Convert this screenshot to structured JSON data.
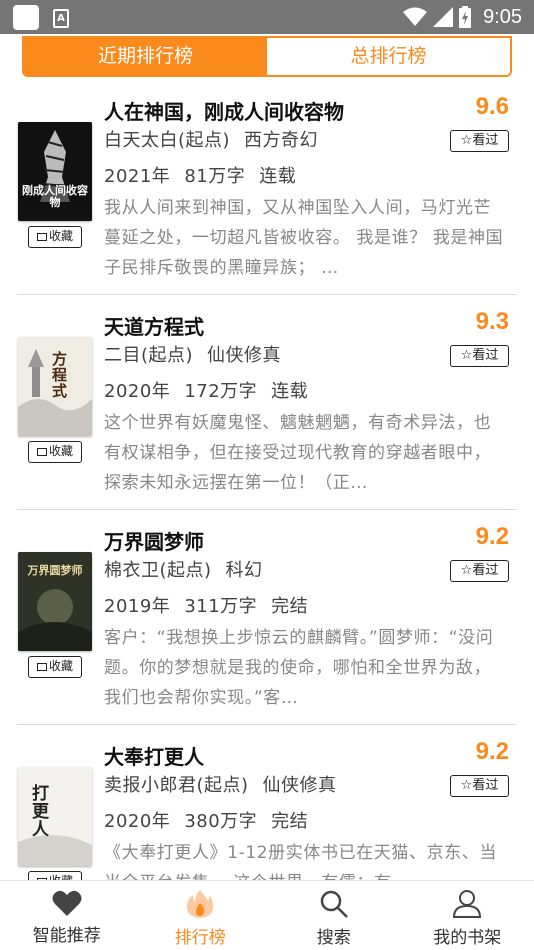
{
  "status_bar": {
    "time": "9:05"
  },
  "tabs": [
    {
      "label": "近期排行榜",
      "active": true
    },
    {
      "label": "总排行榜",
      "active": false
    }
  ],
  "books": [
    {
      "title": "人在神国，刚成人间收容物",
      "score": "9.6",
      "author": "白天太白(起点)",
      "genre": "西方奇幻",
      "year": "2021年",
      "words": "81万字",
      "status": "连载",
      "description": "我从人间来到神国，又从神国坠入人间，马灯光芒蔓延之处，一切超凡皆被收容。 我是谁？ 我是神国子民排斥敬畏的黑瞳异族； …",
      "cover_text": "刚成人间收容物",
      "favorite_label": "收藏",
      "seen_label": "看过"
    },
    {
      "title": "天道方程式",
      "score": "9.3",
      "author": "二目(起点)",
      "genre": "仙侠修真",
      "year": "2020年",
      "words": "172万字",
      "status": "连载",
      "description": "这个世界有妖魔鬼怪、魑魅魍魉，有奇术异法，也有权谋相争，但在接受过现代教育的穿越者眼中，探索未知永远摆在第一位！（正…",
      "cover_text": "方程式",
      "favorite_label": "收藏",
      "seen_label": "看过"
    },
    {
      "title": "万界圆梦师",
      "score": "9.2",
      "author": "棉衣卫(起点)",
      "genre": "科幻",
      "year": "2019年",
      "words": "311万字",
      "status": "完结",
      "description": "客户：“我想换上步惊云的麒麟臂。”圆梦师：“没问题。你的梦想就是我的使命，哪怕和全世界为敌，我们也会帮你实现。”客…",
      "cover_text": "万界圆梦师",
      "favorite_label": "收藏",
      "seen_label": "看过"
    },
    {
      "title": "大奉打更人",
      "score": "9.2",
      "author": "卖报小郎君(起点)",
      "genre": "仙侠修真",
      "year": "2020年",
      "words": "380万字",
      "status": "完结",
      "description": "《大奉打更人》1-12册实体书已在天猫、京东、当当全平台发售。 这个世界，有儒；有…",
      "cover_text": "打更人",
      "favorite_label": "收藏",
      "seen_label": "看过"
    }
  ],
  "bottom_nav": [
    {
      "label": "智能推荐",
      "icon": "heart-icon",
      "active": false
    },
    {
      "label": "排行榜",
      "icon": "flame-icon",
      "active": true
    },
    {
      "label": "搜索",
      "icon": "search-icon",
      "active": false
    },
    {
      "label": "我的书架",
      "icon": "user-icon",
      "active": false
    }
  ],
  "colors": {
    "accent": "#fb8a1d",
    "statusbar": "#757575",
    "muted_text": "#888888"
  }
}
